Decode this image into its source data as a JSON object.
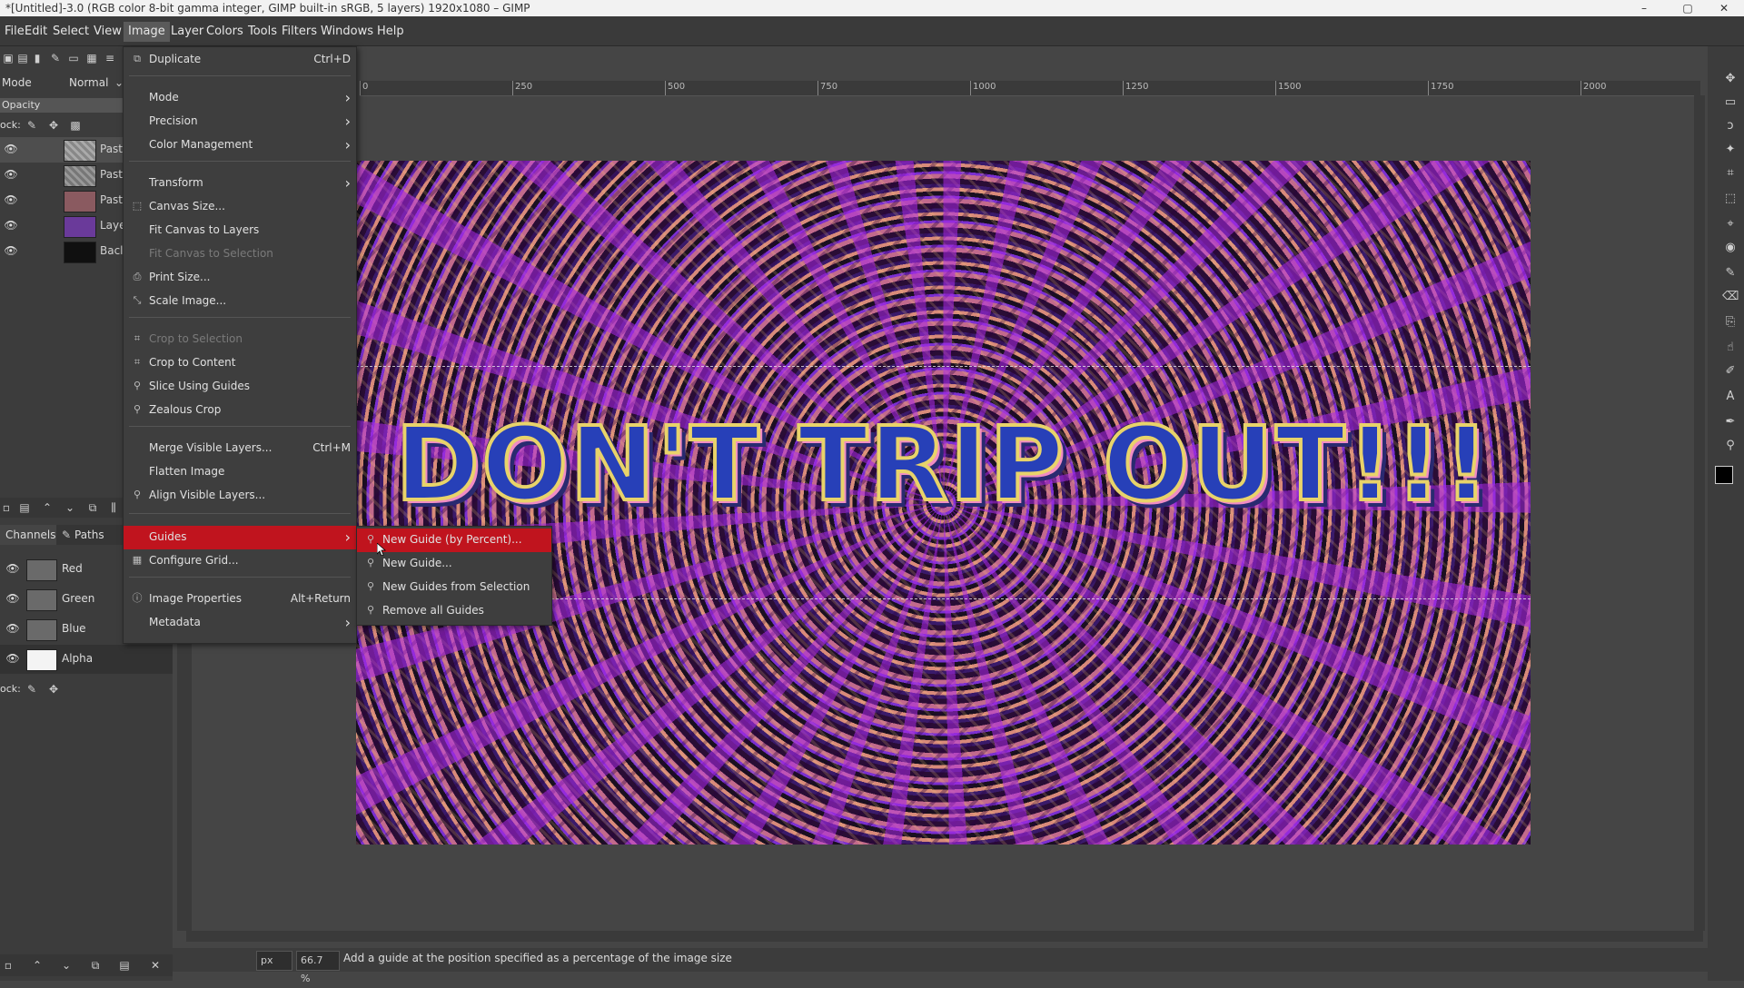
{
  "window": {
    "title": "*[Untitled]-3.0 (RGB color 8-bit gamma integer, GIMP built-in sRGB, 5 layers) 1920x1080 – GIMP",
    "minimize": "–",
    "maximize": "▢",
    "close": "✕"
  },
  "menubar": [
    "File",
    "Edit",
    "Select",
    "View",
    "Image",
    "Layer",
    "Colors",
    "Tools",
    "Filters",
    "Windows",
    "Help"
  ],
  "tool_options": {
    "mode_label": "Mode",
    "mode_value": "Normal",
    "opacity_label": "Opacity",
    "lock_label": "ock:"
  },
  "layers": [
    {
      "name": "Past",
      "eye": "👁"
    },
    {
      "name": "Past",
      "eye": "👁"
    },
    {
      "name": "Past",
      "eye": "👁"
    },
    {
      "name": "Laye",
      "eye": "👁"
    },
    {
      "name": "Bacl",
      "eye": "👁"
    }
  ],
  "dock_tabs": {
    "channels": "Channels",
    "paths": "Paths"
  },
  "channels": [
    {
      "name": "Red"
    },
    {
      "name": "Green"
    },
    {
      "name": "Blue"
    },
    {
      "name": "Alpha"
    }
  ],
  "channels_lock_label": "ock:",
  "ruler": {
    "labels": [
      "0",
      "250",
      "500",
      "750",
      "1000",
      "1250",
      "1500",
      "1750",
      "2000"
    ]
  },
  "image_text": "DON'T TRIP OUT!!!",
  "image_menu": {
    "items": [
      {
        "label": "Duplicate",
        "shortcut": "Ctrl+D",
        "icon": "duplicate-icon"
      },
      {
        "label": "Mode",
        "submenu": true
      },
      {
        "label": "Precision",
        "submenu": true
      },
      {
        "label": "Color Management",
        "submenu": true
      },
      {
        "label": "Transform",
        "submenu": true
      },
      {
        "label": "Canvas Size...",
        "icon": "canvas-size-icon"
      },
      {
        "label": "Fit Canvas to Layers"
      },
      {
        "label": "Fit Canvas to Selection",
        "disabled": true
      },
      {
        "label": "Print Size...",
        "icon": "print-size-icon"
      },
      {
        "label": "Scale Image...",
        "icon": "scale-icon"
      },
      {
        "label": "Crop to Selection",
        "disabled": true,
        "icon": "crop-icon"
      },
      {
        "label": "Crop to Content",
        "icon": "crop-icon"
      },
      {
        "label": "Slice Using Guides",
        "icon": "slice-icon"
      },
      {
        "label": "Zealous Crop",
        "icon": "zealous-icon"
      },
      {
        "label": "Merge Visible Layers...",
        "shortcut": "Ctrl+M"
      },
      {
        "label": "Flatten Image"
      },
      {
        "label": "Align Visible Layers...",
        "icon": "align-icon"
      },
      {
        "label": "Guides",
        "submenu": true,
        "highlighted": true
      },
      {
        "label": "Configure Grid...",
        "icon": "grid-icon"
      },
      {
        "label": "Image Properties",
        "shortcut": "Alt+Return",
        "icon": "info-icon"
      },
      {
        "label": "Metadata",
        "submenu": true
      }
    ]
  },
  "guides_menu": {
    "items": [
      {
        "label": "New Guide (by Percent)...",
        "highlighted": true
      },
      {
        "label": "New Guide..."
      },
      {
        "label": "New Guides from Selection"
      },
      {
        "label": "Remove all Guides"
      }
    ]
  },
  "statusbar": {
    "unit": "px",
    "zoom": "66.7 %",
    "message": "Add a guide at the position specified as a percentage of the image size"
  },
  "colors": {
    "menu_highlight": "#c0141e",
    "background": "#454545",
    "text_blue": "#2740b8",
    "text_outline": "#e8d36a"
  }
}
